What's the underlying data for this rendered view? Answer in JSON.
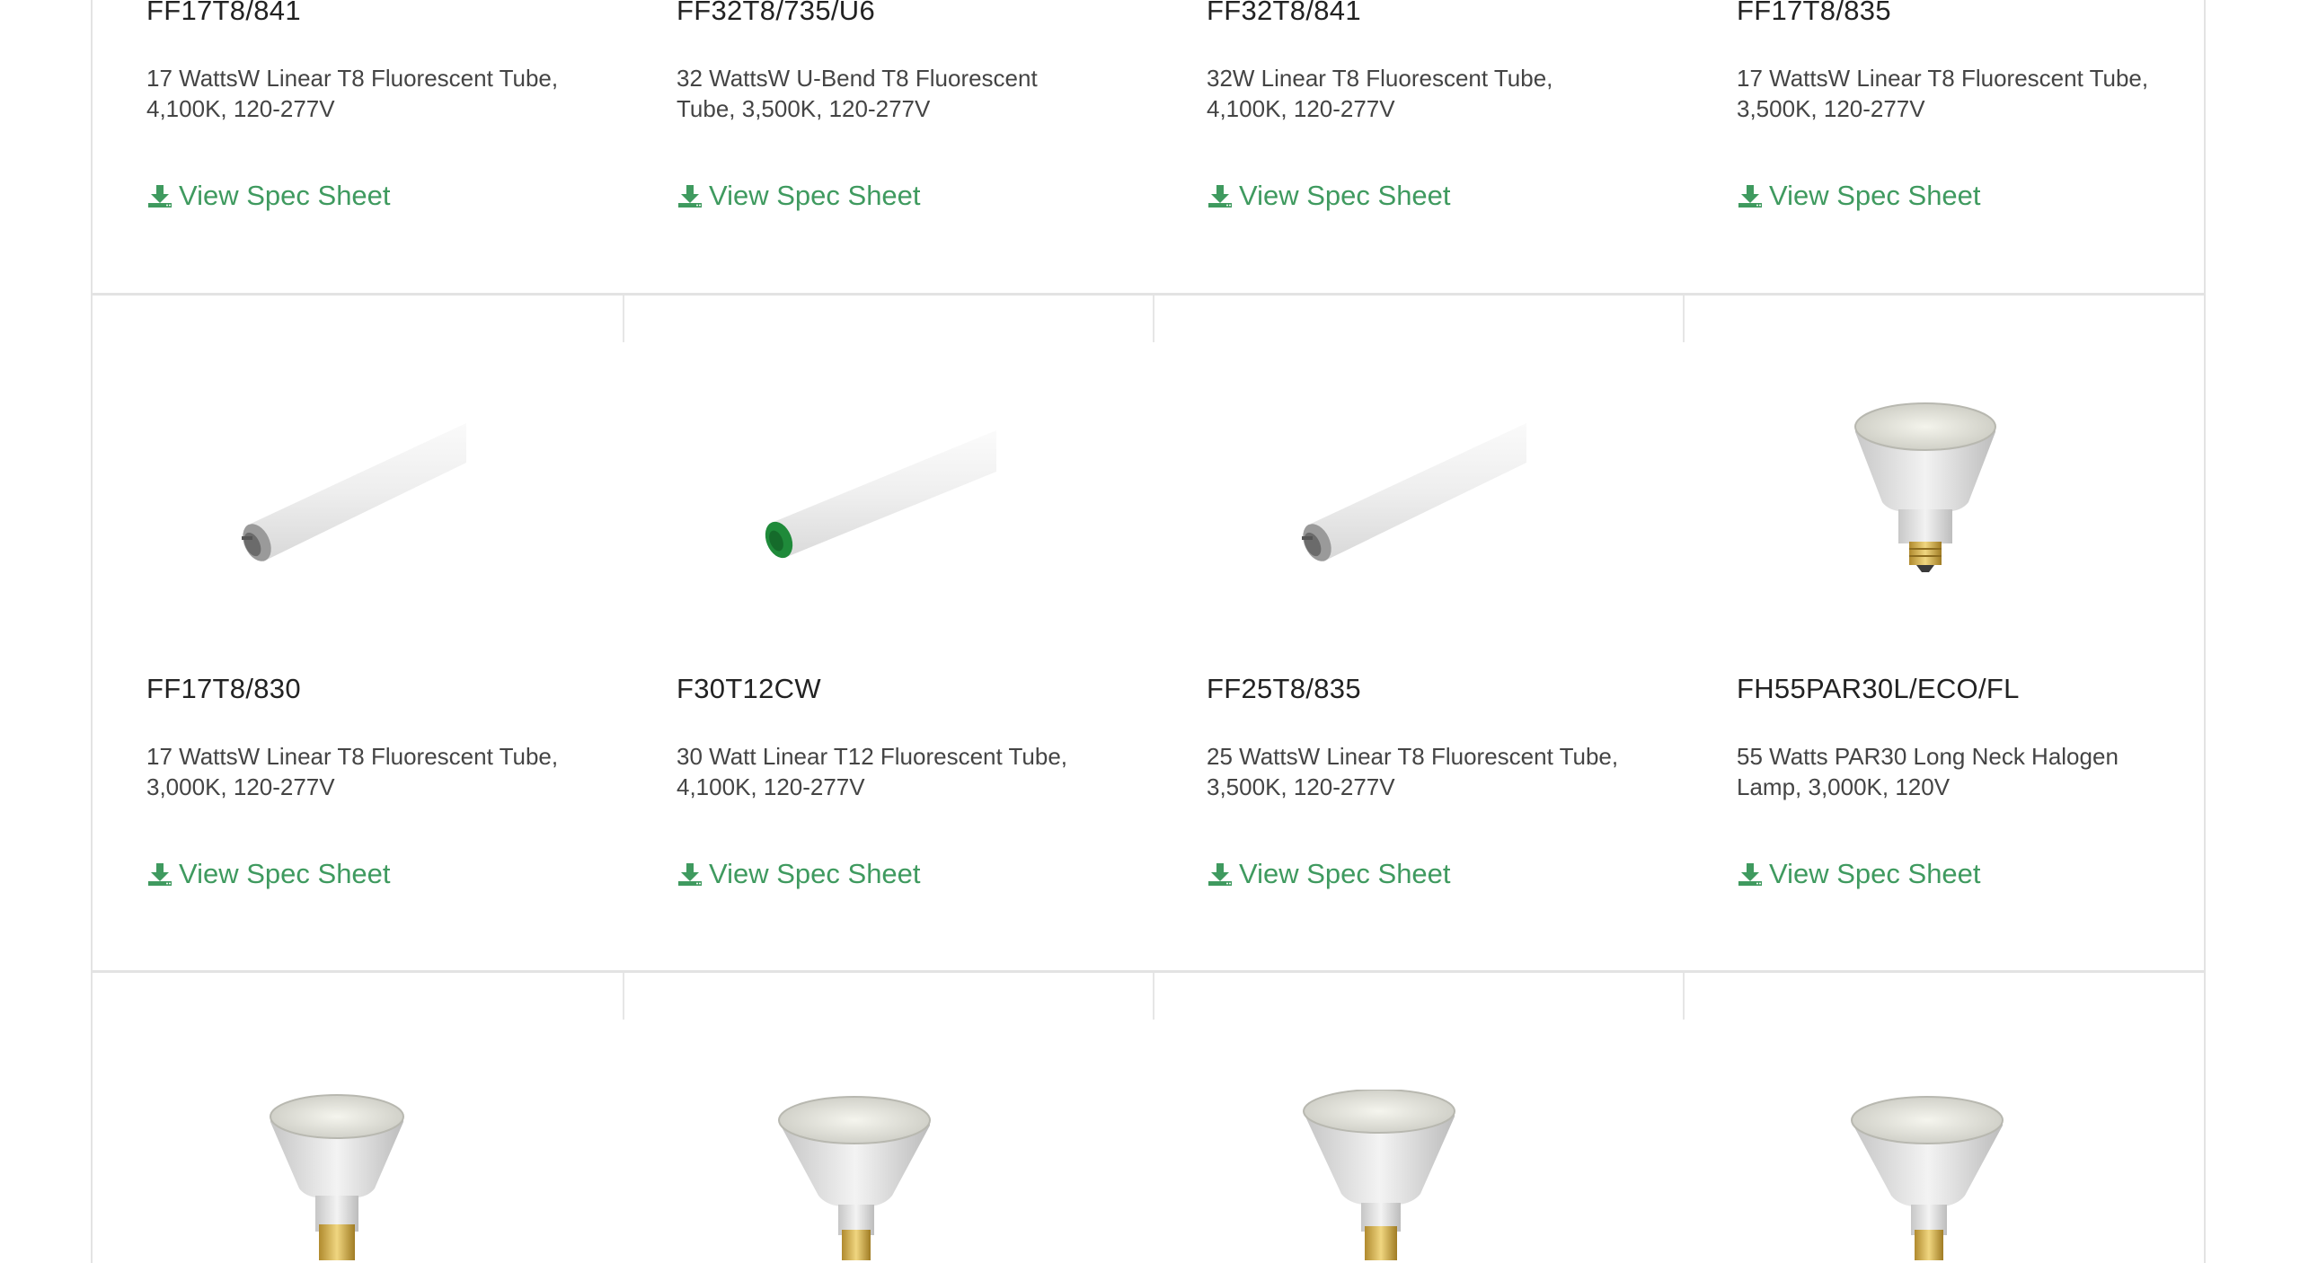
{
  "rows": [
    {
      "cards": [
        {
          "sku": "FF17T8/841",
          "desc": "17 WattsW Linear T8 Fluorescent Tube, 4,100K, 120-277V",
          "link": "View Spec Sheet",
          "image": "none"
        },
        {
          "sku": "FF32T8/735/U6",
          "desc": "32 WattsW U-Bend T8 Fluorescent Tube, 3,500K, 120-277V",
          "link": "View Spec Sheet",
          "image": "none"
        },
        {
          "sku": "FF32T8/841",
          "desc": "32W Linear T8 Fluorescent Tube, 4,100K, 120-277V",
          "link": "View Spec Sheet",
          "image": "none"
        },
        {
          "sku": "FF17T8/835",
          "desc": "17 WattsW Linear T8 Fluorescent Tube, 3,500K, 120-277V",
          "link": "View Spec Sheet",
          "image": "none"
        }
      ]
    },
    {
      "cards": [
        {
          "sku": "FF17T8/830",
          "desc": "17 WattsW Linear T8 Fluorescent Tube, 3,000K, 120-277V",
          "link": "View Spec Sheet",
          "image": "fluorescent-tube-image"
        },
        {
          "sku": "F30T12CW",
          "desc": "30 Watt Linear T12 Fluorescent Tube, 4,100K, 120-277V",
          "link": "View Spec Sheet",
          "image": "fluorescent-tube-green-end-image"
        },
        {
          "sku": "FF25T8/835",
          "desc": "25 WattsW Linear T8 Fluorescent Tube, 3,500K, 120-277V",
          "link": "View Spec Sheet",
          "image": "fluorescent-tube-image"
        },
        {
          "sku": "FH55PAR30L/ECO/FL",
          "desc": "55 Watts PAR30 Long Neck Halogen Lamp, 3,000K, 120V",
          "link": "View Spec Sheet",
          "image": "par30-halogen-lamp-image"
        }
      ]
    },
    {
      "cards": [
        {
          "image": "par-halogen-lamp-image"
        },
        {
          "image": "par-halogen-lamp-image"
        },
        {
          "image": "par-halogen-lamp-image"
        },
        {
          "image": "par-halogen-lamp-image"
        }
      ]
    }
  ],
  "icons": {
    "download": "download-icon"
  },
  "colors": {
    "link_green": "#3f9a5f",
    "border": "#e3e3e3",
    "text_dark": "#222222",
    "text_body": "#444444"
  }
}
